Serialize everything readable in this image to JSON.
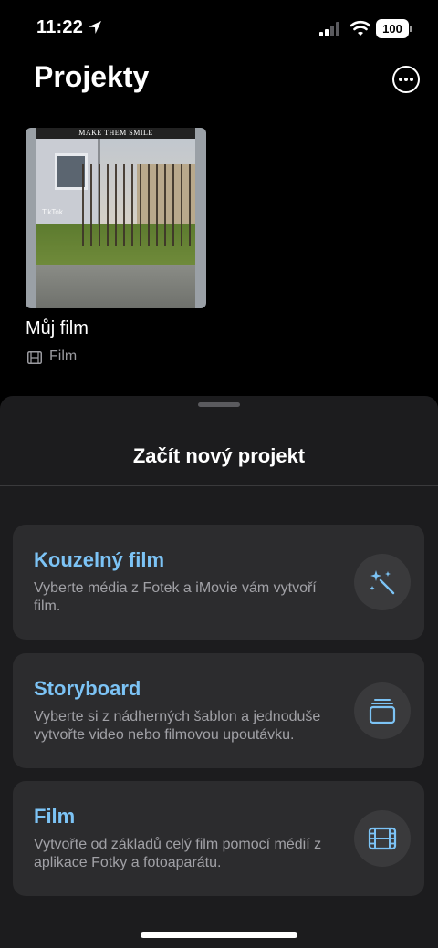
{
  "status_bar": {
    "time": "11:22",
    "battery": "100",
    "icons": [
      "location-arrow-icon",
      "signal-icon",
      "wifi-icon",
      "battery-icon"
    ]
  },
  "header": {
    "title": "Projekty",
    "more_icon": "ellipsis-circle-icon"
  },
  "projects": [
    {
      "title": "Můj film",
      "type": "Film",
      "type_icon": "film-icon",
      "thumbnail_caption": "MAKE THEM SMILE",
      "thumbnail_watermark": "TikTok"
    }
  ],
  "sheet": {
    "title": "Začít nový projekt",
    "options": [
      {
        "title": "Kouzelný film",
        "description": "Vyberte média z Fotek a iMovie vám vytvoří film.",
        "icon": "magic-wand-icon"
      },
      {
        "title": "Storyboard",
        "description": "Vyberte si z nádherných šablon a jednoduše vytvořte video nebo filmovou upoutávku.",
        "icon": "storyboard-stack-icon"
      },
      {
        "title": "Film",
        "description": "Vytvořte od základů celý film pomocí médií z aplikace Fotky a fotoaparátu.",
        "icon": "film-strip-icon"
      }
    ]
  },
  "colors": {
    "background": "#000000",
    "sheet": "#1c1c1e",
    "card": "#2c2c2e",
    "accent": "#7cc3f5",
    "secondary_text": "#a1a1a6"
  }
}
